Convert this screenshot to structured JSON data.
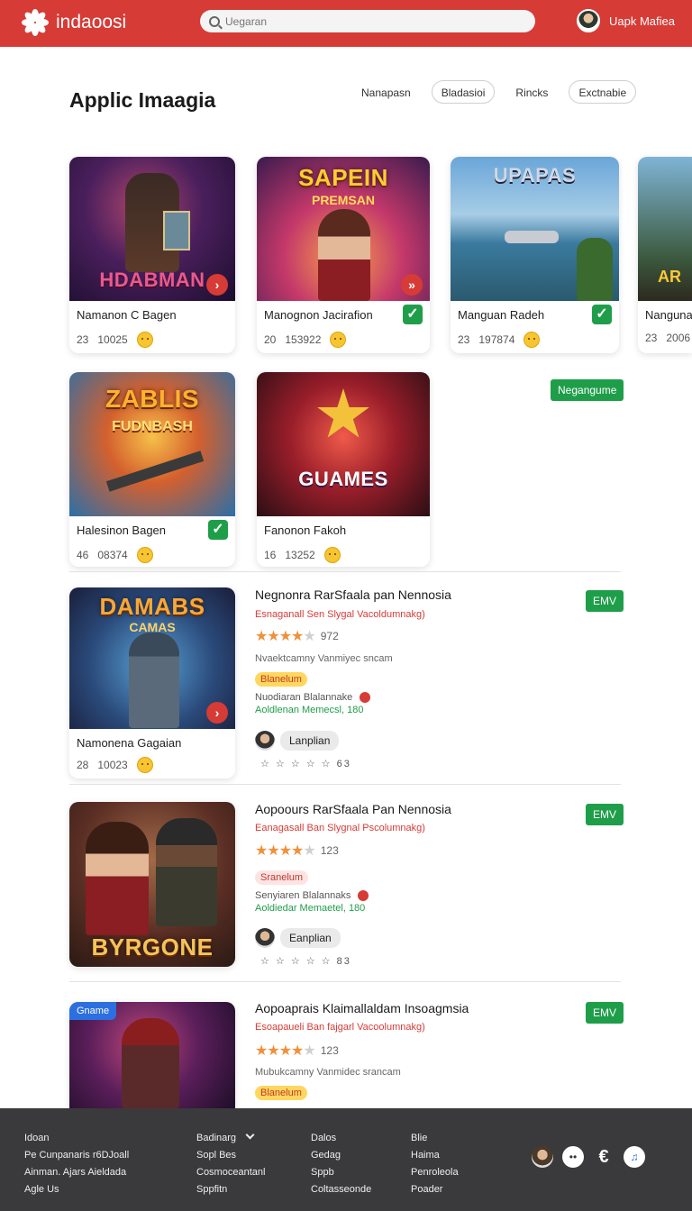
{
  "header": {
    "logo_text": "indaoosi",
    "search_placeholder": "Uegaran",
    "user_name": "Uapk Mafiea"
  },
  "page": {
    "title": "Applic Imaagia",
    "filters": [
      "Nanapasn",
      "Bladasioi",
      "Rincks",
      "Exctnabie"
    ]
  },
  "grid": {
    "cards": [
      {
        "thumb_text": "HDABMAN",
        "name": "Namanon C Bagen",
        "num1": "23",
        "num2": "10025",
        "badge": "play"
      },
      {
        "thumb_text": "SAPEIN",
        "thumb_sub": "PREMSAN",
        "name": "Manognon Jacirafion",
        "num1": "20",
        "num2": "153922",
        "badge": "check"
      },
      {
        "thumb_text": "UPAPAS",
        "name": "Manguan Radeh",
        "num1": "23",
        "num2": "197874",
        "badge": "check"
      },
      {
        "thumb_text": "AR",
        "name": "Nanguna",
        "num1": "23",
        "num2": "2006",
        "badge": ""
      },
      {
        "thumb_text": "ZABLIS",
        "thumb_sub": "FUDNBASH",
        "name": "Halesinon Bagen",
        "num1": "46",
        "num2": "08374",
        "badge": "check"
      },
      {
        "thumb_text": "GUAMES",
        "name": "Fanonon Fakoh",
        "num1": "16",
        "num2": "13252",
        "badge": ""
      }
    ],
    "green_tag": "Negangume"
  },
  "list": [
    {
      "thumb_text": "DAMABS",
      "thumb_sub": "CAMAS",
      "thumb_name": "Namonena Gagaian",
      "thumb_num1": "28",
      "thumb_num2": "10023",
      "title": "Negnonra RarSfaala pan Nennosia",
      "subtitle": "Esnaganall Sen Slygal Vacoldumnakg)",
      "rating_count": "972",
      "stars_on": 4,
      "desc": "Nvaektcamny Vanmiyec sncam",
      "pill": "Blanelum",
      "info": "Nuodiaran Blalannake",
      "green": "Aoldlenan Memecsl, 180",
      "dev": "Lanplian",
      "small_rating": "☆ ☆ ☆ ☆ ☆ 63",
      "tag": "EMV"
    },
    {
      "thumb_text": "BYRGONE",
      "title": "Aopoours RarSfaala Pan Nennosia",
      "subtitle": "Eanagasall Ban Slygnal Pscolumnakg)",
      "rating_count": "123",
      "stars_on": 4,
      "pill": "Sranelum",
      "info": "Senyiaren Blalannaks",
      "green": "Aoldiedar Memaetel, 180",
      "dev": "Eanplian",
      "small_rating": "☆ ☆ ☆ ☆ ☆ 83",
      "tag": "EMV"
    },
    {
      "thumb_badge": "Gname",
      "title": "Aopoaprais Klaimallaldam Insoagmsia",
      "subtitle": "Esoapaueli Ban fajgarl Vacoolumnakg)",
      "rating_count": "123",
      "stars_on": 4,
      "desc": "Mubukcamny Vanmidec srancam",
      "pill": "Blanelum",
      "tag": "EMV"
    }
  ],
  "footer": {
    "columns": [
      [
        "Idoan",
        "Pe Cunpanaris r6DJoall",
        "Ainman. Ajars Aieldada",
        "Agle Us"
      ],
      [
        "Badinarg",
        "Sopl Bes",
        "Cosmoceantanl",
        "Sppfitn"
      ],
      [
        "Dalos",
        "Gedag",
        "Sppb",
        "Coltasseonde"
      ],
      [
        "Blie",
        "Haima",
        "Penroleola",
        "Poader"
      ]
    ]
  },
  "colors": {
    "brand_red": "#d63b36",
    "green": "#1f9e4a",
    "footer_bg": "#3a3a3c",
    "star": "#f0903a"
  }
}
